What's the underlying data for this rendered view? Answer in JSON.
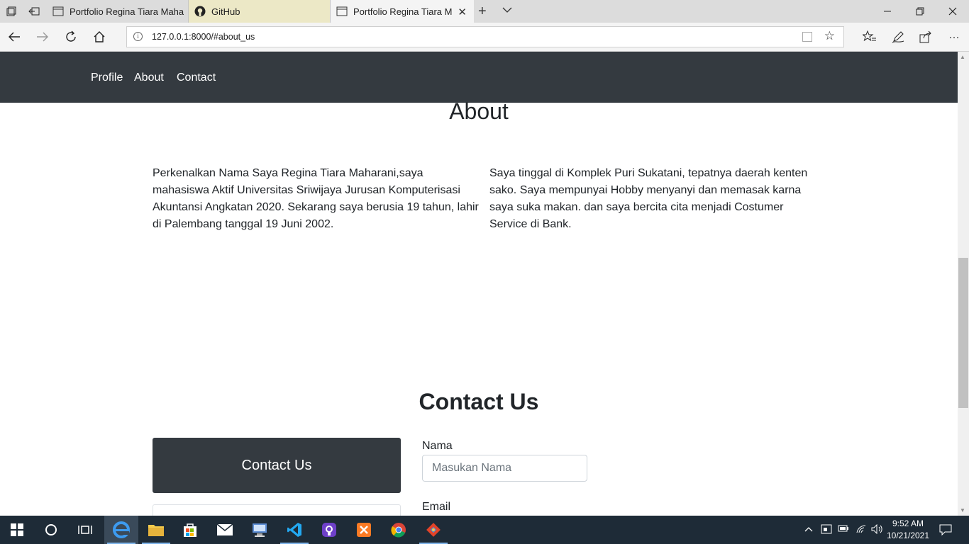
{
  "browser": {
    "tabs": [
      {
        "label": "Portfolio Regina Tiara Maha",
        "icon": "page-icon"
      },
      {
        "label": "GitHub",
        "icon": "github-icon"
      },
      {
        "label": "Portfolio Regina Tiara M",
        "icon": "page-icon",
        "active": true
      }
    ],
    "url": "127.0.0.1:8000/#about_us"
  },
  "site": {
    "nav": {
      "profile": "Profile",
      "about": "About",
      "contact": "Contact"
    },
    "about": {
      "title": "About",
      "left": "Perkenalkan Nama Saya Regina Tiara Maharani,saya mahasiswa Aktif Universitas Sriwijaya Jurusan Komputerisasi Akuntansi Angkatan 2020. Sekarang saya berusia 19 tahun, lahir di Palembang tanggal 19 Juni 2002.",
      "right": "Saya tinggal di Komplek Puri Sukatani, tepatnya daerah kenten sako. Saya mempunyai Hobby menyanyi dan memasak karna saya suka makan. dan saya bercita cita menjadi Costumer Service di Bank."
    },
    "contact": {
      "title": "Contact Us",
      "card_title": "Contact Us",
      "name_label": "Nama",
      "name_placeholder": "Masukan Nama",
      "email_label": "Email"
    }
  },
  "taskbar": {
    "time": "9:52 AM",
    "date": "10/21/2021"
  },
  "colors": {
    "navbar": "#343a40",
    "taskbar": "#1e2b37"
  }
}
